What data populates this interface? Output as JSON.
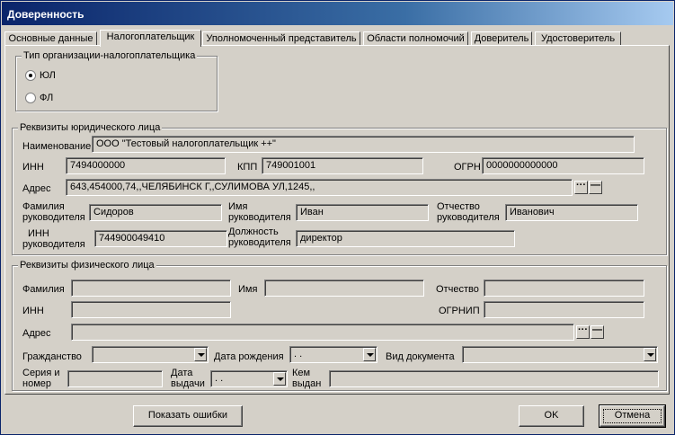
{
  "window": {
    "title": "Доверенность"
  },
  "tabs": [
    "Основные данные",
    "Налогоплательщик",
    "Уполномоченный представитель",
    "Области полномочий",
    "Доверитель",
    "Удостоверитель"
  ],
  "active_tab": "Налогоплательщик",
  "org_type": {
    "legend": "Тип организации-налогоплательщика",
    "options": [
      "ЮЛ",
      "ФЛ"
    ],
    "selected": "ЮЛ"
  },
  "legal": {
    "legend": "Реквизиты юридического лица",
    "name_label": "Наименование",
    "name_value": "ООО \"Тестовый налогоплательщик ++\"",
    "inn_label": "ИНН",
    "inn_value": "7494000000",
    "kpp_label": "КПП",
    "kpp_value": "749001001",
    "ogrn_label": "ОГРН",
    "ogrn_value": "0000000000000",
    "address_label": "Адрес",
    "address_value": "643,454000,74,,ЧЕЛЯБИНСК Г,,СУЛИМОВА УЛ,1245,,",
    "head_lastname_label_1": "Фамилия",
    "head_lastname_label_2": "руководителя",
    "head_lastname_value": "Сидоров",
    "head_firstname_label_1": "Имя",
    "head_firstname_label_2": "руководителя",
    "head_firstname_value": "Иван",
    "head_patronymic_label_1": "Отчество",
    "head_patronymic_label_2": "руководителя",
    "head_patronymic_value": "Иванович",
    "head_inn_label_1": "ИНН",
    "head_inn_label_2": "руководителя",
    "head_inn_value": "744900049410",
    "head_position_label_1": "Должность",
    "head_position_label_2": "руководителя",
    "head_position_value": "директор"
  },
  "physical": {
    "legend": "Реквизиты физического лица",
    "lastname_label": "Фамилия",
    "firstname_label": "Имя",
    "patronymic_label": "Отчество",
    "inn_label": "ИНН",
    "ogrnip_label": "ОГРНИП",
    "address_label": "Адрес",
    "citizenship_label": "Гражданство",
    "birthdate_label": "Дата рождения",
    "birthdate_value": ". .",
    "doctype_label": "Вид документа",
    "series_label_1": "Серия и",
    "series_label_2": "номер",
    "issue_date_label_1": "Дата",
    "issue_date_label_2": "выдачи",
    "issue_date_value": ". .",
    "issued_by_label_1": "Кем",
    "issued_by_label_2": "выдан"
  },
  "buttons": {
    "show_errors": "Показать ошибки",
    "ok": "OK",
    "cancel": "Отмена",
    "ellipsis": "···",
    "clear": "—"
  }
}
